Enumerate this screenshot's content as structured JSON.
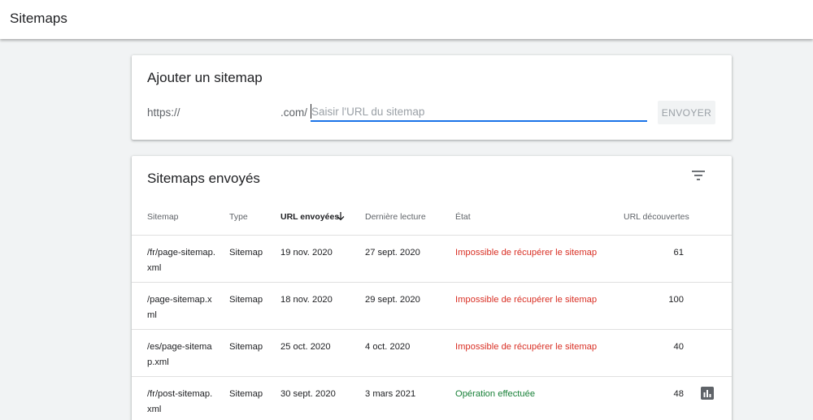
{
  "header": {
    "title": "Sitemaps"
  },
  "add_sitemap": {
    "title": "Ajouter un sitemap",
    "prefix": "https://",
    "suffix": ".com/",
    "input_placeholder": "Saisir l'URL du sitemap",
    "input_value": "",
    "submit_label": "ENVOYER"
  },
  "sent_sitemaps": {
    "title": "Sitemaps envoyés",
    "filter_icon": "filter-icon",
    "columns": {
      "sitemap": "Sitemap",
      "type": "Type",
      "sent": "URL envoyées",
      "last_read": "Dernière lecture",
      "status": "État",
      "discovered": "URL découvertes"
    },
    "sort": {
      "column": "sent",
      "direction": "desc",
      "icon": "arrow-down-icon"
    },
    "rows": [
      {
        "sitemap": "/fr/page-sitemap.xml",
        "type": "Sitemap",
        "sent": "19 nov. 2020",
        "last_read": "27 sept. 2020",
        "status": "Impossible de récupérer le sitemap",
        "status_kind": "error",
        "discovered": "61",
        "has_chart": false
      },
      {
        "sitemap": "/page-sitemap.xml",
        "type": "Sitemap",
        "sent": "18 nov. 2020",
        "last_read": "29 sept. 2020",
        "status": "Impossible de récupérer le sitemap",
        "status_kind": "error",
        "discovered": "100",
        "has_chart": false
      },
      {
        "sitemap": "/es/page-sitemap.xml",
        "type": "Sitemap",
        "sent": "25 oct. 2020",
        "last_read": "4 oct. 2020",
        "status": "Impossible de récupérer le sitemap",
        "status_kind": "error",
        "discovered": "40",
        "has_chart": false
      },
      {
        "sitemap": "/fr/post-sitemap.xml",
        "type": "Sitemap",
        "sent": "30 sept. 2020",
        "last_read": "3 mars 2021",
        "status": "Opération effectuée",
        "status_kind": "success",
        "discovered": "48",
        "has_chart": true
      }
    ]
  },
  "colors": {
    "accent": "#1a73e8",
    "error": "#d93025",
    "success": "#188038",
    "background": "#f1f3f4"
  }
}
